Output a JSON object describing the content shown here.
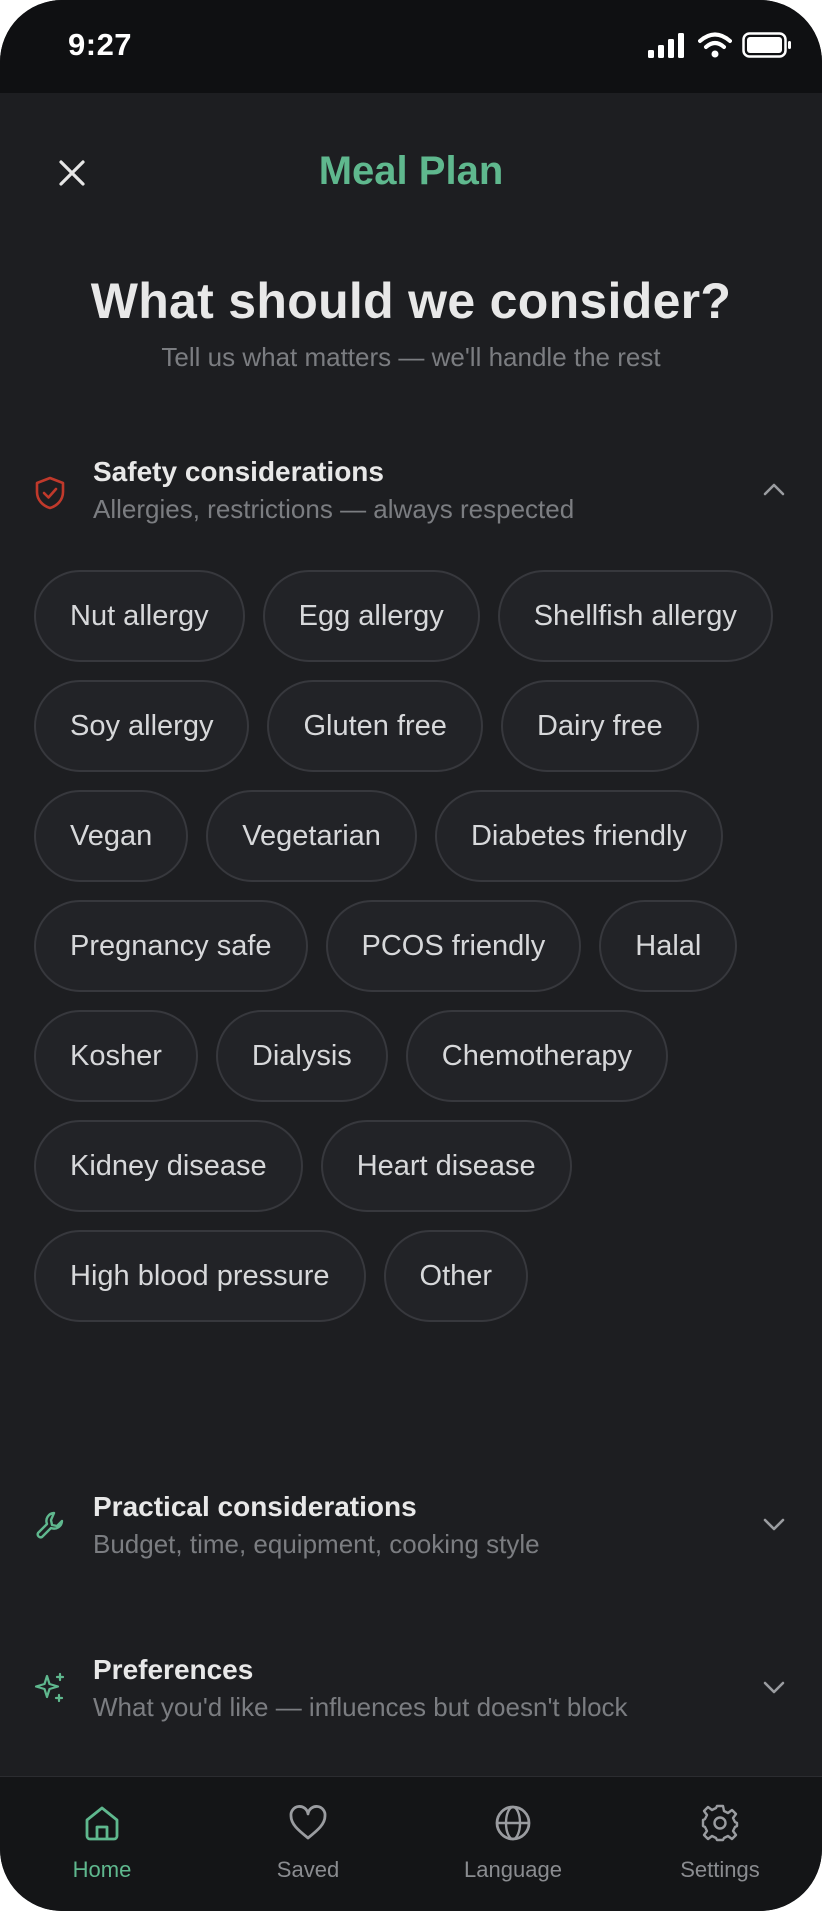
{
  "status_bar": {
    "time": "9:27"
  },
  "header": {
    "title": "Meal Plan"
  },
  "intro": {
    "heading": "What should we consider?",
    "subheading": "Tell us what matters — we'll handle the rest"
  },
  "sections": {
    "safety": {
      "title": "Safety considerations",
      "description": "Allergies, restrictions — always respected",
      "icon": "shield-check-icon",
      "expanded": true
    },
    "practical": {
      "title": "Practical considerations",
      "description": "Budget, time, equipment, cooking style",
      "icon": "wrench-icon",
      "expanded": false
    },
    "preferences": {
      "title": "Preferences",
      "description": "What you'd like — influences but doesn't block",
      "icon": "sparkles-icon",
      "expanded": false
    }
  },
  "safety_options": [
    "Nut allergy",
    "Egg allergy",
    "Shellfish allergy",
    "Soy allergy",
    "Gluten free",
    "Dairy free",
    "Vegan",
    "Vegetarian",
    "Diabetes friendly",
    "Pregnancy safe",
    "PCOS friendly",
    "Halal",
    "Kosher",
    "Dialysis",
    "Chemotherapy",
    "Kidney disease",
    "Heart disease",
    "High blood pressure",
    "Other"
  ],
  "tabs": {
    "home": {
      "label": "Home",
      "active": true
    },
    "saved": {
      "label": "Saved"
    },
    "language": {
      "label": "Language"
    },
    "settings": {
      "label": "Settings"
    }
  },
  "colors": {
    "accent": "#5fb88e",
    "safety_icon": "#c0392b",
    "background": "#1d1e21"
  }
}
